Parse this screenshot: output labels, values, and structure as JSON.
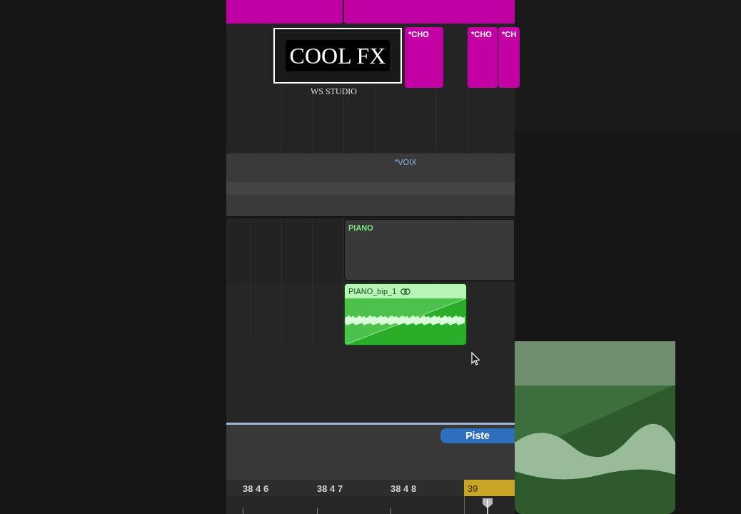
{
  "overlay": {
    "title": "COOL FX",
    "caption": "WS STUDIO"
  },
  "cho_regions": [
    "*CHO",
    "*CHO",
    "*CH"
  ],
  "voix_label": "*VOIX",
  "piano_region": {
    "label": "PIANO"
  },
  "audio_region": {
    "label": "PIANO_bip_1"
  },
  "piste_button": "Piste",
  "ruler": {
    "labels": [
      "38 4 6",
      "38 4 7",
      "38 4 8"
    ],
    "current": "39"
  }
}
